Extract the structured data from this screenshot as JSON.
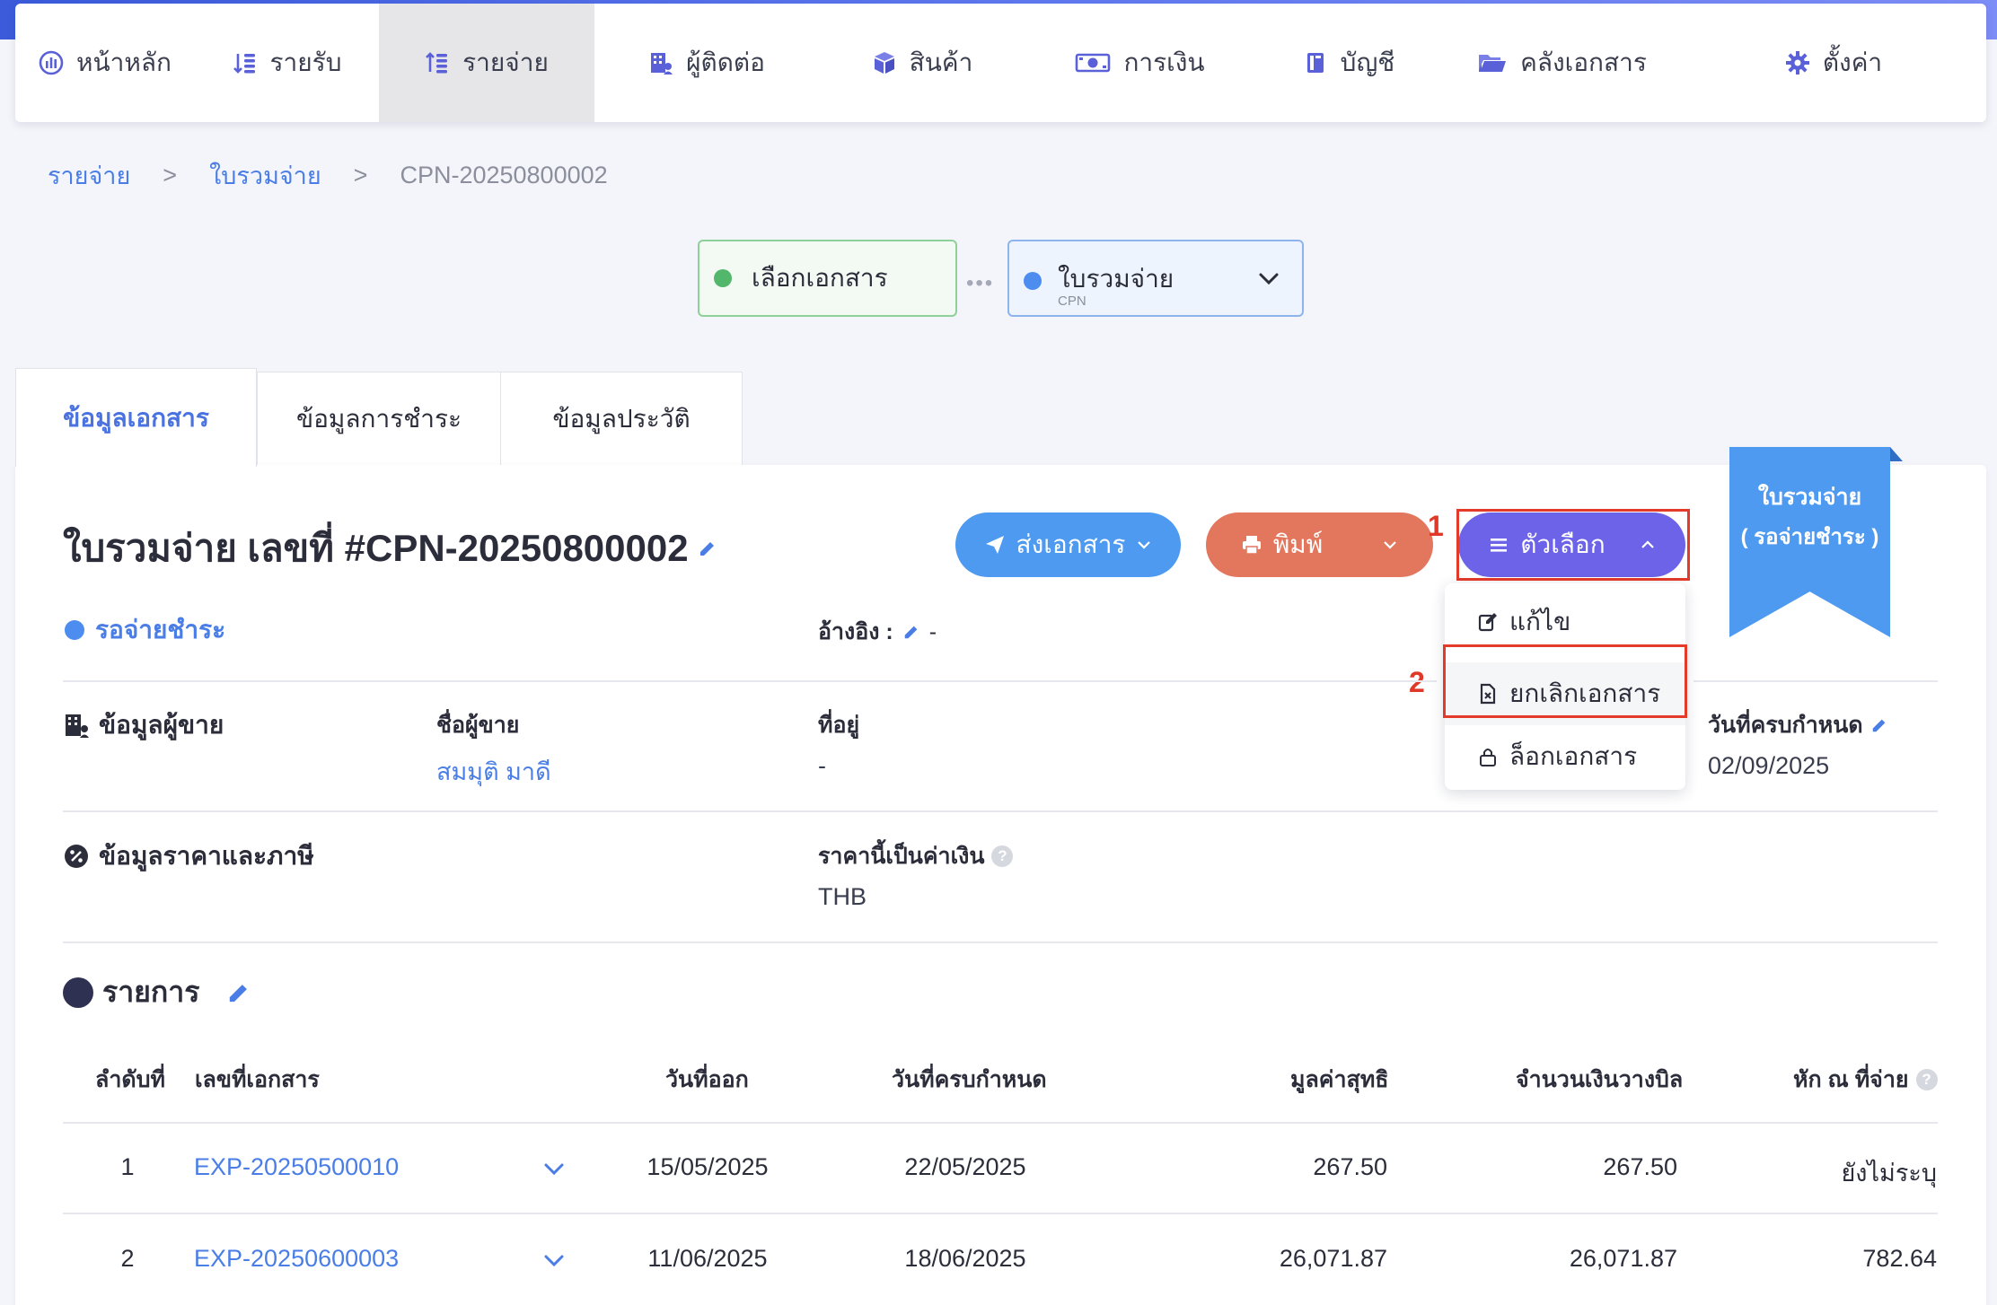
{
  "nav": {
    "items": [
      {
        "label": "หน้าหลัก",
        "icon": "dashboard-icon"
      },
      {
        "label": "รายรับ",
        "icon": "income-icon"
      },
      {
        "label": "รายจ่าย",
        "icon": "expense-icon"
      },
      {
        "label": "ผู้ติดต่อ",
        "icon": "contacts-icon"
      },
      {
        "label": "สินค้า",
        "icon": "product-box-icon"
      },
      {
        "label": "การเงิน",
        "icon": "money-icon"
      },
      {
        "label": "บัญชี",
        "icon": "accounting-book-icon"
      },
      {
        "label": "คลังเอกสาร",
        "icon": "folder-icon"
      },
      {
        "label": "ตั้งค่า",
        "icon": "gear-icon"
      }
    ],
    "active_index": 2
  },
  "breadcrumb": {
    "level1": "รายจ่าย",
    "level2": "ใบรวมจ่าย",
    "current": "CPN-20250800002",
    "separator": ">"
  },
  "workflow": {
    "step1": {
      "label": "เลือกเอกสาร",
      "color": "#52b76a"
    },
    "step2": {
      "label": "ใบรวมจ่าย",
      "sub": "CPN",
      "color": "#4d8df0"
    }
  },
  "tabs": [
    {
      "label": "ข้อมูลเอกสาร",
      "active": true
    },
    {
      "label": "ข้อมูลการชำระ",
      "active": false
    },
    {
      "label": "ข้อมูลประวัติ",
      "active": false
    }
  ],
  "document": {
    "title": "ใบรวมจ่าย เลขที่ #CPN-20250800002",
    "status": "รอจ่ายชำระ",
    "reference_label": "อ้างอิง :",
    "reference_value": "-"
  },
  "actions": {
    "send_label": "ส่งเอกสาร",
    "print_label": "พิมพ์",
    "options_label": "ตัวเลือก",
    "send_color": "#4d9af0",
    "print_color": "#e3775d",
    "options_color": "#6c63e8"
  },
  "options_menu": {
    "items": [
      {
        "label": "แก้ไข",
        "icon": "edit-icon"
      },
      {
        "label": "ยกเลิกเอกสาร",
        "icon": "cancel-document-icon"
      },
      {
        "label": "ล็อกเอกสาร",
        "icon": "lock-icon"
      }
    ]
  },
  "annotations": {
    "marker1": "1",
    "marker2": "2"
  },
  "ribbon": {
    "line1": "ใบรวมจ่าย",
    "line2": "( รอจ่ายชำระ )"
  },
  "seller": {
    "section_label": "ข้อมูลผู้ขาย",
    "name_label": "ชื่อผู้ขาย",
    "name_value": "สมมุติ มาดี",
    "address_label": "ที่อยู่",
    "address_value": "-",
    "due_label": "วันที่ครบกำหนด",
    "due_value": "02/09/2025"
  },
  "pricing": {
    "section_label": "ข้อมูลราคาและภาษี",
    "currency_label": "ราคานี้เป็นค่าเงิน",
    "currency_value": "THB"
  },
  "items": {
    "section_label": "รายการ",
    "columns": {
      "index": "ลำดับที่",
      "doc_no": "เลขที่เอกสาร",
      "issue_date": "วันที่ออก",
      "due_date": "วันที่ครบกำหนด",
      "net": "มูลค่าสุทธิ",
      "billed": "จำนวนเงินวางบิล",
      "withholding": "หัก ณ ที่จ่าย"
    },
    "rows": [
      {
        "index": "1",
        "doc_no": "EXP-20250500010",
        "issue_date": "15/05/2025",
        "due_date": "22/05/2025",
        "net": "267.50",
        "billed": "267.50",
        "withholding": "ยังไม่ระบุ"
      },
      {
        "index": "2",
        "doc_no": "EXP-20250600003",
        "issue_date": "11/06/2025",
        "due_date": "18/06/2025",
        "net": "26,071.87",
        "billed": "26,071.87",
        "withholding": "782.64"
      }
    ]
  }
}
